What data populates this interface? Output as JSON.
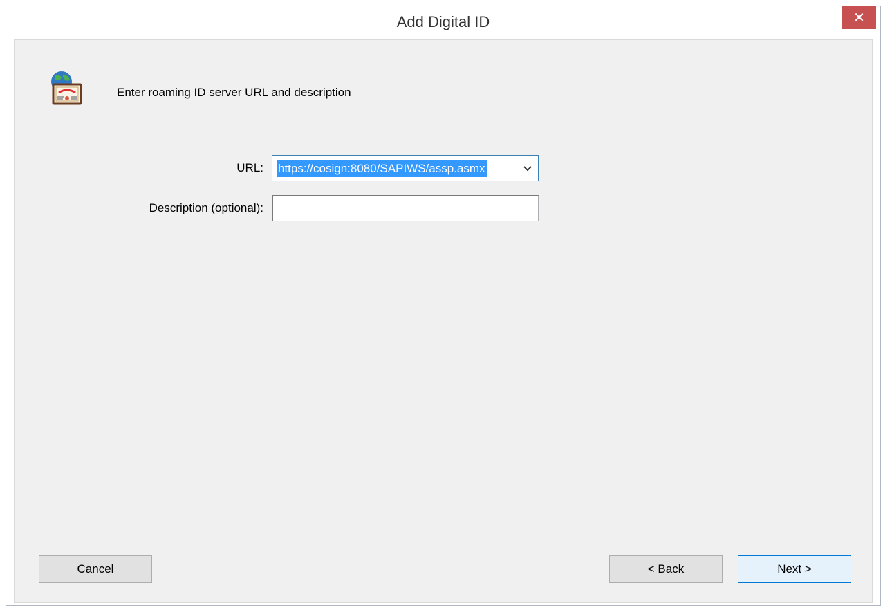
{
  "window": {
    "title": "Add Digital ID",
    "close_label": "✕"
  },
  "header": {
    "icon": "digital-id-certificate-globe-icon",
    "instruction": "Enter roaming ID server URL and description"
  },
  "form": {
    "url": {
      "label": "URL:",
      "value": "https://cosign:8080/SAPIWS/assp.asmx",
      "selected": true
    },
    "description": {
      "label": "Description (optional):",
      "value": ""
    }
  },
  "buttons": {
    "cancel": "Cancel",
    "back": "< Back",
    "next": "Next >"
  },
  "colors": {
    "close_button": "#c75050",
    "selection": "#3399ff",
    "dialog_background": "#f0f0f0",
    "focus_border": "#0078d7"
  }
}
